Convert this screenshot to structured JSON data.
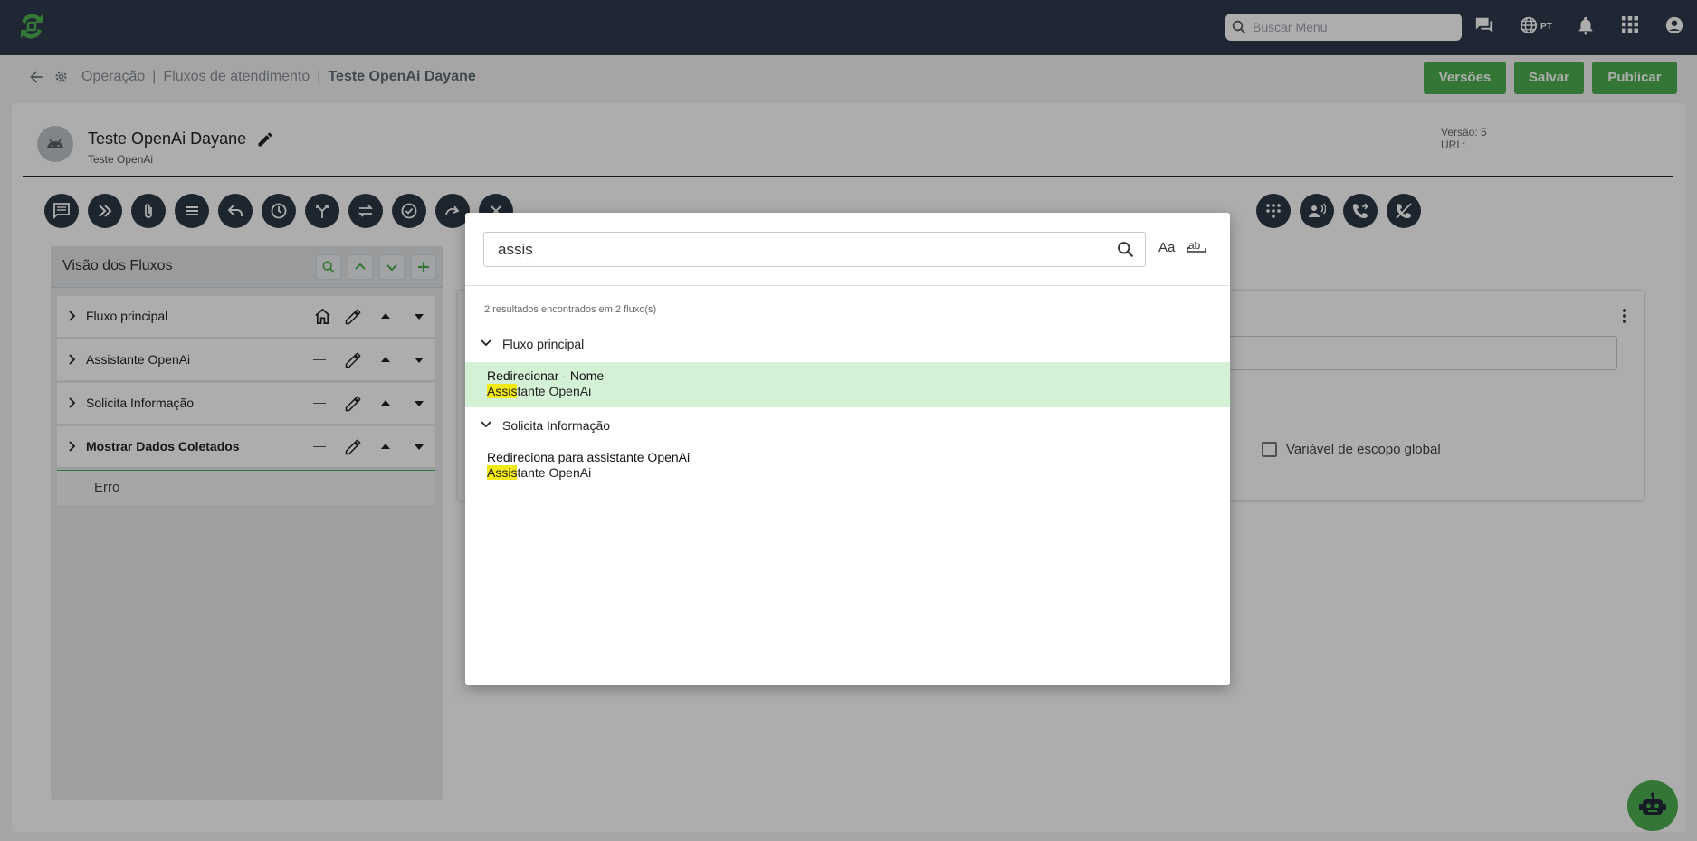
{
  "app": {
    "search_placeholder": "Buscar Menu",
    "language": "PT",
    "icons": [
      "chat-icon",
      "globe-icon",
      "bell-icon",
      "apps-grid-icon",
      "account-icon"
    ]
  },
  "breadcrumb": {
    "items": [
      "Operação",
      "Fluxos de atendimento"
    ],
    "current": "Teste OpenAi Dayane"
  },
  "actions": {
    "versions": "Versões",
    "save": "Salvar",
    "publish": "Publicar"
  },
  "flow": {
    "title": "Teste OpenAi Dayane",
    "subtitle": "Teste OpenAi",
    "version_label": "Versão: 5",
    "url_label": "URL:"
  },
  "panel": {
    "title": "Visão dos Fluxos",
    "rows": [
      {
        "name": "Fluxo principal",
        "home": true,
        "bold": false
      },
      {
        "name": "Assistante OpenAi",
        "home": false,
        "bold": false
      },
      {
        "name": "Solicita Informação",
        "home": false,
        "bold": false
      },
      {
        "name": "Mostrar Dados Coletados",
        "home": false,
        "bold": true
      }
    ],
    "subitem": "Erro"
  },
  "right": {
    "checkbox_label": "Variável de escopo global"
  },
  "search_modal": {
    "query": "assis",
    "match_case_label": "Aa",
    "match_word_label": "ab",
    "result_count": "2 resultados encontrados em 2 fluxo(s)",
    "groups": [
      {
        "name": "Fluxo principal",
        "results": [
          {
            "title": "Redirecionar - Nome",
            "match": "Assis",
            "rest": "tante OpenAi",
            "active": true
          }
        ]
      },
      {
        "name": "Solicita Informação",
        "results": [
          {
            "title": "Redireciona para assistante OpenAi",
            "match": "Assis",
            "rest": "tante OpenAi",
            "active": false
          }
        ]
      }
    ]
  },
  "colors": {
    "topbar": "#2d3a4c",
    "accent_green": "#4caf50",
    "highlight": "#f2ea14",
    "active_result": "#d4f1d6"
  }
}
